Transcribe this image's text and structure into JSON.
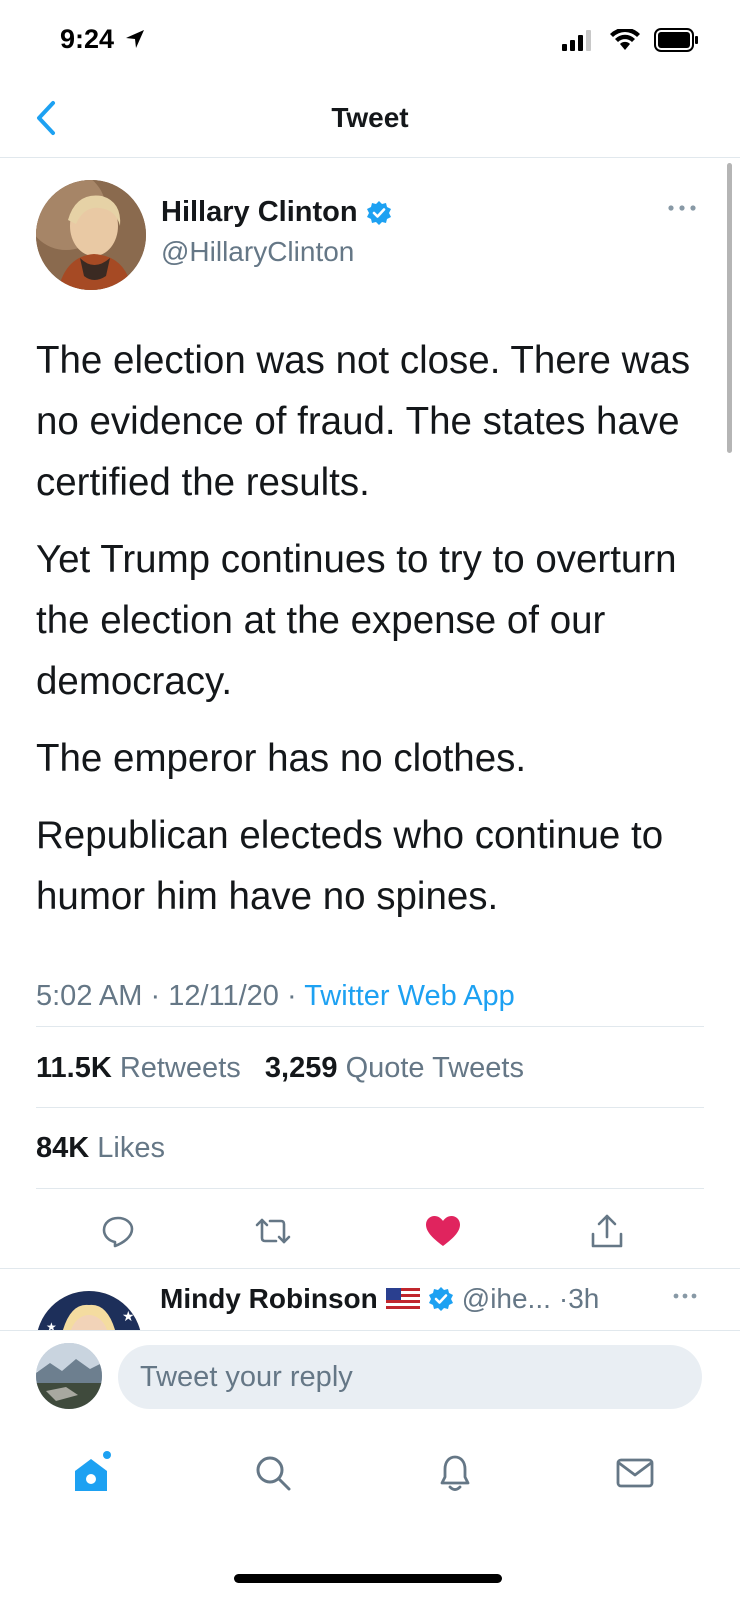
{
  "status_bar": {
    "time": "9:24"
  },
  "nav": {
    "title": "Tweet"
  },
  "tweet": {
    "author_name": "Hillary Clinton",
    "author_handle": "@HillaryClinton",
    "paragraphs": [
      "The election was not close. There was no evidence of fraud. The states have certified the results.",
      "Yet Trump continues to try to overturn the election at the expense of our democracy.",
      "The emperor has no clothes.",
      "Republican electeds who continue to humor him have no spines."
    ],
    "time": "5:02 AM",
    "date": "12/11/20",
    "source": "Twitter Web App",
    "retweets_count": "11.5K",
    "retweets_label": "Retweets",
    "quotes_count": "3,259",
    "quotes_label": "Quote Tweets",
    "likes_count": "84K",
    "likes_label": "Likes"
  },
  "reply_preview": {
    "name": "Mindy Robinson",
    "handle": "@ihe...",
    "time": "3h"
  },
  "composer": {
    "placeholder": "Tweet your reply"
  },
  "colors": {
    "accent": "#1da1f2",
    "like": "#e0245e",
    "secondary_text": "#657786"
  }
}
